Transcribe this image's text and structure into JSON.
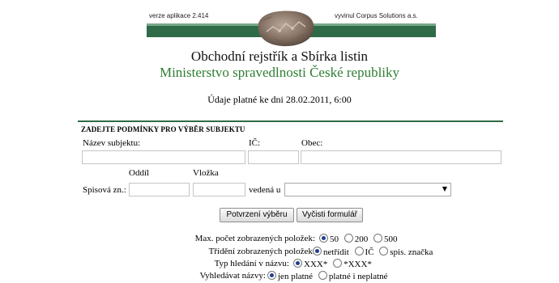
{
  "header": {
    "version": "verze aplikace 2.414",
    "vendor": "vyvinul Corpus Solutions a.s.",
    "logo_icon": "stone-emblem-icon",
    "title": "Obchodní rejstřík a Sbírka listin",
    "subtitle": "Ministerstvo spravedlnosti České republiky",
    "valid": "Údaje platné ke dni 28.02.2011, 6:00",
    "accent_color": "#2f6b47",
    "subtitle_color": "#2e7d32"
  },
  "form": {
    "section_title": "ZADEJTE PODMÍNKY PRO VÝBĚR SUBJEKTU",
    "name_label": "Název subjektu:",
    "ic_label": "IČ:",
    "obec_label": "Obec:",
    "name_value": "",
    "ic_value": "",
    "obec_value": "",
    "oddil_label": "Oddíl",
    "vlozka_label": "Vložka",
    "spis_label": "Spisová zn.:",
    "oddil_value": "",
    "vlozka_value": "",
    "vedena_label": "vedená u",
    "court_selected": ""
  },
  "buttons": {
    "submit": "Potvrzení výběru",
    "clear": "Vyčisti formulář"
  },
  "options": {
    "max_label": "Max. počet zobrazených položek:",
    "max_choices": [
      "50",
      "200",
      "500"
    ],
    "max_selected": "50",
    "sort_label": "Třídění zobrazených položek:",
    "sort_choices": [
      "netřídit",
      "IČ",
      "spis. značka"
    ],
    "sort_selected": "netřídit",
    "search_label": "Typ hledání v názvu:",
    "search_choices": [
      "XXX*",
      "*XXX*"
    ],
    "search_selected": "XXX*",
    "find_label": "Vyhledávat názvy:",
    "find_choices": [
      "jen platné",
      "platné i neplatné"
    ],
    "find_selected": "jen platné"
  }
}
